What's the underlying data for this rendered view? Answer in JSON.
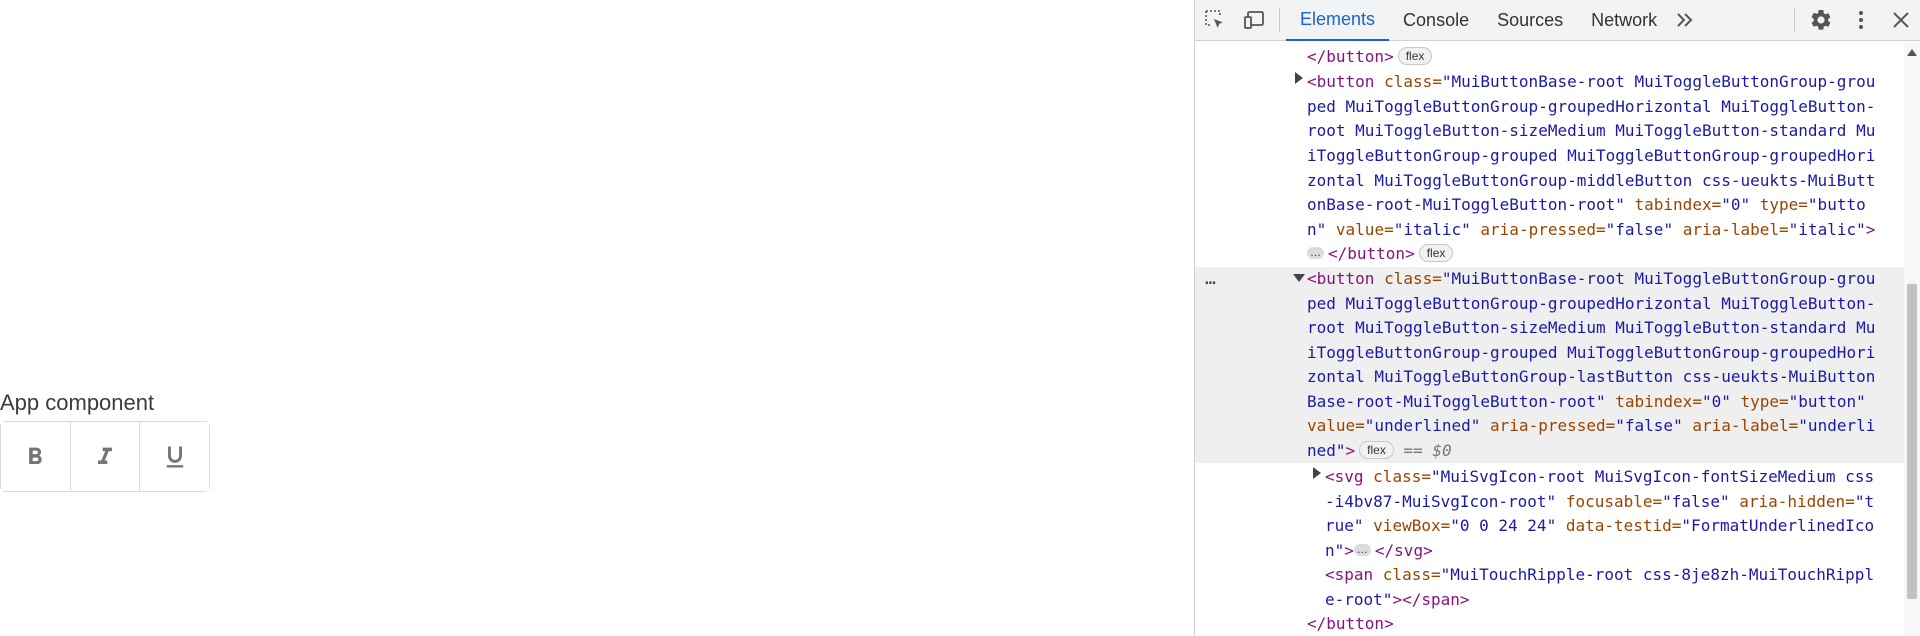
{
  "app": {
    "title": "App component",
    "buttons": [
      {
        "value": "bold",
        "icon": "bold-icon"
      },
      {
        "value": "italic",
        "icon": "italic-icon"
      },
      {
        "value": "underlined",
        "icon": "underline-icon"
      }
    ]
  },
  "devtools": {
    "tabs": [
      "Elements",
      "Console",
      "Sources",
      "Network"
    ],
    "active_tab": "Elements",
    "badges": {
      "flex": "flex"
    },
    "ellipsis": "…",
    "selected_marker": "== $0",
    "colors": {
      "accent": "#1a62d6",
      "tag": "#881280",
      "attr": "#994500",
      "value": "#1a1aa6"
    },
    "icons": [
      "inspect-element-icon",
      "device-toolbar-icon",
      "more-tabs-icon",
      "settings-icon",
      "kebab-menu-icon",
      "close-icon"
    ]
  },
  "code": {
    "l0": "</button>",
    "b1_l1_tag": "<button ",
    "b1_l1_attr": "class=",
    "b1_l1_val": "\"MuiButtonBase-root MuiToggleButtonGroup-grou",
    "b1_l2": "ped MuiToggleButtonGroup-groupedHorizontal MuiToggleButton-",
    "b1_l3": "root MuiToggleButton-sizeMedium MuiToggleButton-standard Mu",
    "b1_l4": "iToggleButtonGroup-grouped MuiToggleButtonGroup-groupedHori",
    "b1_l5": "zontal MuiToggleButtonGroup-middleButton css-ueukts-MuiButt",
    "b1_l6_val": "onBase-root-MuiToggleButton-root\" ",
    "b1_l6_a1": "tabindex=",
    "b1_l6_v1": "\"0\" ",
    "b1_l6_a2": "type=",
    "b1_l6_v2": "\"butto",
    "b1_l7_v": "n\" ",
    "b1_l7_a1": "value=",
    "b1_l7_v1": "\"italic\" ",
    "b1_l7_a2": "aria-pressed=",
    "b1_l7_v2": "\"false\" ",
    "b1_l7_a3": "aria-label=",
    "b1_l7_v3": "\"italic\"",
    "b1_l7_end": ">",
    "b1_l8_close": "</button>",
    "b2_l1_tag": "<button ",
    "b2_l1_attr": "class=",
    "b2_l1_val": "\"MuiButtonBase-root MuiToggleButtonGroup-grou",
    "b2_l2": "ped MuiToggleButtonGroup-groupedHorizontal MuiToggleButton-",
    "b2_l3": "root MuiToggleButton-sizeMedium MuiToggleButton-standard Mu",
    "b2_l4": "iToggleButtonGroup-grouped MuiToggleButtonGroup-groupedHori",
    "b2_l5": "zontal MuiToggleButtonGroup-lastButton css-ueukts-MuiButton",
    "b2_l6_val": "Base-root-MuiToggleButton-root\" ",
    "b2_l6_a1": "tabindex=",
    "b2_l6_v1": "\"0\" ",
    "b2_l6_a2": "type=",
    "b2_l6_v2": "\"button\"",
    "b2_l7_a1": "value=",
    "b2_l7_v1": "\"underlined\" ",
    "b2_l7_a2": "aria-pressed=",
    "b2_l7_v2": "\"false\" ",
    "b2_l7_a3": "aria-label=",
    "b2_l7_v3": "\"underli",
    "b2_l8_v": "ned\"",
    "b2_l8_end": ">",
    "svg_l1_tag": "<svg ",
    "svg_l1_a1": "class=",
    "svg_l1_v1": "\"MuiSvgIcon-root MuiSvgIcon-fontSizeMedium css",
    "svg_l2_v": "-i4bv87-MuiSvgIcon-root\" ",
    "svg_l2_a1": "focusable=",
    "svg_l2_v1": "\"false\" ",
    "svg_l2_a2": "aria-hidden=",
    "svg_l2_v2": "\"t",
    "svg_l3_v": "rue\" ",
    "svg_l3_a1": "viewBox=",
    "svg_l3_v1": "\"0 0 24 24\" ",
    "svg_l3_a2": "data-testid=",
    "svg_l3_v2": "\"FormatUnderlinedIco",
    "svg_l4_v": "n\"",
    "svg_l4_end": ">",
    "svg_l4_close": "</svg>",
    "span_l1_tag": "<span ",
    "span_l1_a1": "class=",
    "span_l1_v1": "\"MuiTouchRipple-root css-8je8zh-MuiTouchRippl",
    "span_l2_v": "e-root\"",
    "span_l2_end": "></span>",
    "close_button": "</button>"
  }
}
